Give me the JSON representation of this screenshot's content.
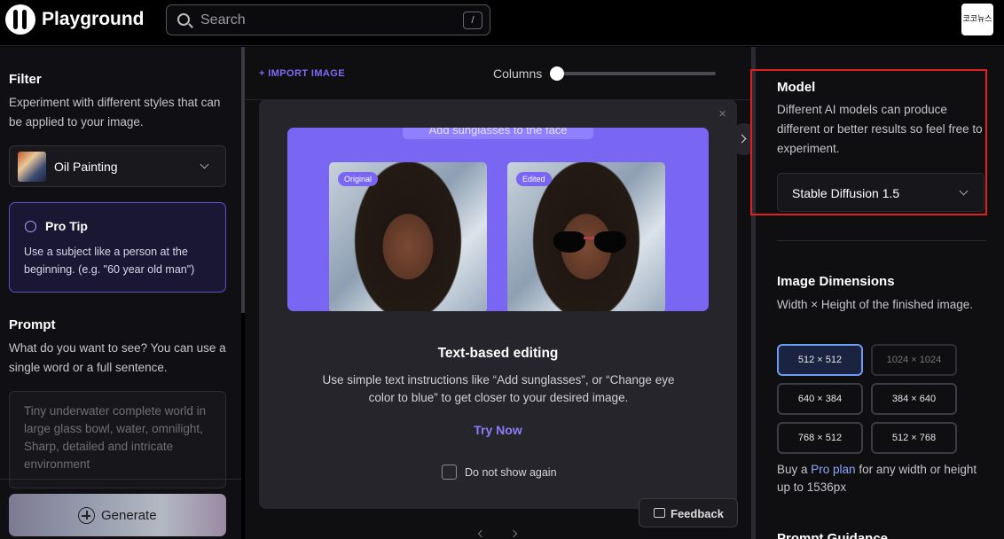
{
  "header": {
    "brand": "Playground",
    "search_placeholder": "Search",
    "shortcut": "/",
    "avatar_text": "코코뉴스"
  },
  "filter": {
    "title": "Filter",
    "description": "Experiment with different styles that can be applied to your image.",
    "selected": "Oil Painting"
  },
  "protip": {
    "title": "Pro Tip",
    "text": "Use a subject like a person at the beginning. (e.g. \"60 year old man\")"
  },
  "prompt": {
    "title": "Prompt",
    "description": "What do you want to see? You can use a single word or a full sentence.",
    "placeholder": "Tiny underwater complete world in large glass bowl, water, omnilight, Sharp, detailed and intricate environment"
  },
  "generate_label": "Generate",
  "toolbar": {
    "import_label": "+ IMPORT IMAGE",
    "columns_label": "Columns"
  },
  "modal": {
    "hero_pill": "Add sunglasses to the face",
    "original_tag": "Original",
    "edited_tag": "Edited",
    "title": "Text-based editing",
    "text": "Use simple text instructions like “Add sunglasses”, or “Change eye color to blue” to get closer to your desired image.",
    "try_now": "Try Now",
    "do_not_show": "Do not show again",
    "close": "×"
  },
  "feedback_label": "Feedback",
  "model": {
    "title": "Model",
    "description": "Different AI models can produce different or better results so feel free to experiment.",
    "selected": "Stable Diffusion 1.5"
  },
  "dimensions": {
    "title": "Image Dimensions",
    "description": "Width × Height of the finished image.",
    "options": [
      "512 × 512",
      "1024 × 1024",
      "640 × 384",
      "384 × 640",
      "768 × 512",
      "512 × 768"
    ],
    "buy_prefix": "Buy a ",
    "buy_link": "Pro plan",
    "buy_suffix": " for any width or height up to 1536px"
  },
  "next_section": "Prompt Guidance",
  "colors": {
    "accent": "#7966f2",
    "highlight": "#e01f1f"
  }
}
